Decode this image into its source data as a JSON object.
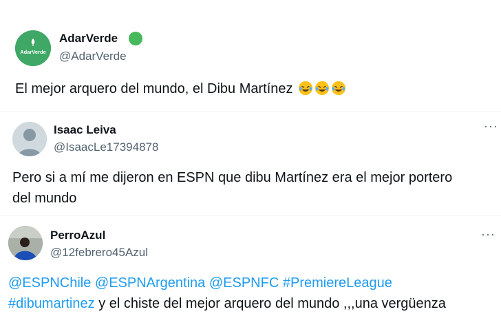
{
  "tweets": [
    {
      "name": "AdarVerde",
      "handle": "@AdarVerde",
      "avatar_text": "AdarVerde",
      "verified_color": "#47b85b",
      "text": "El mejor arquero del mundo, el Dibu Martínez",
      "emoji": "rolling-on-floor-laughing x3"
    },
    {
      "name": "Isaac Leiva",
      "handle": "@IsaacLe17394878",
      "more": "···",
      "text_lines": [
        "Pero si a mí me dijeron en ESPN que dibu Martínez era el mejor portero",
        "del mundo"
      ]
    },
    {
      "name": "PerroAzul",
      "handle": "@12febrero45Azul",
      "more": "···",
      "mentions": [
        "@ESPNChile",
        "@ESPNArgentina",
        "@ESPNFC",
        "#PremiereLeague",
        "#dibumartinez"
      ],
      "text_tail": "y el chiste del mejor arquero del mundo ,,,una vergüenza"
    }
  ],
  "colors": {
    "link": "#1d9bf0",
    "secondary": "#536471",
    "avatar_green": "#3fa866"
  }
}
